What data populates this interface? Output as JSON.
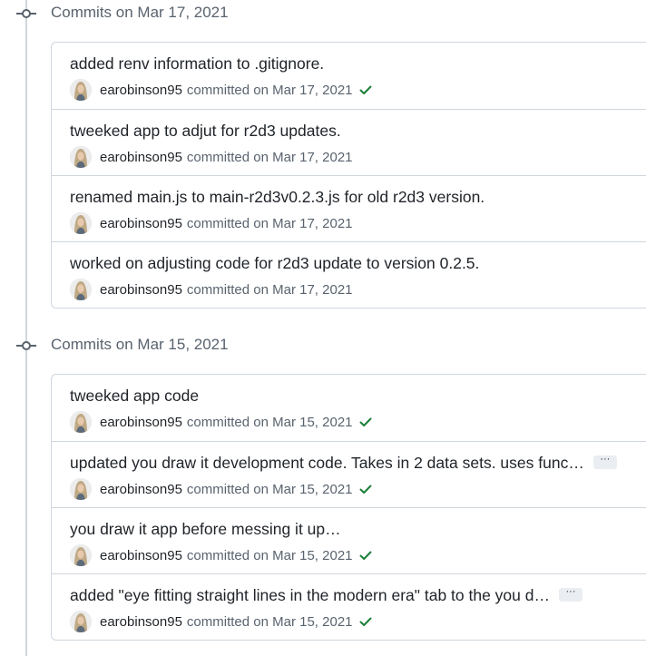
{
  "colors": {
    "line": "#d0d7de",
    "muted": "#59636e",
    "text": "#1f2328",
    "success": "#1a7f37"
  },
  "groups": [
    {
      "title": "Commits on Mar 17, 2021",
      "commits": [
        {
          "message": "added renv information to .gitignore.",
          "author": "earobinson95",
          "committed_text": "committed on Mar 17, 2021",
          "status": "success",
          "truncated": false
        },
        {
          "message": "tweeked app to adjut for r2d3 updates.",
          "author": "earobinson95",
          "committed_text": "committed on Mar 17, 2021",
          "status": "none",
          "truncated": false
        },
        {
          "message": "renamed main.js to main-r2d3v0.2.3.js for old r2d3 version.",
          "author": "earobinson95",
          "committed_text": "committed on Mar 17, 2021",
          "status": "none",
          "truncated": false
        },
        {
          "message": "worked on adjusting code for r2d3 update to version 0.2.5.",
          "author": "earobinson95",
          "committed_text": "committed on Mar 17, 2021",
          "status": "none",
          "truncated": false
        }
      ]
    },
    {
      "title": "Commits on Mar 15, 2021",
      "commits": [
        {
          "message": "tweeked app code",
          "author": "earobinson95",
          "committed_text": "committed on Mar 15, 2021",
          "status": "success",
          "truncated": false
        },
        {
          "message": "updated you draw it development code. Takes in 2 data sets. uses func…",
          "author": "earobinson95",
          "committed_text": "committed on Mar 15, 2021",
          "status": "success",
          "truncated": true
        },
        {
          "message": "you draw it app before messing it up…",
          "author": "earobinson95",
          "committed_text": "committed on Mar 15, 2021",
          "status": "success",
          "truncated": false
        },
        {
          "message": "added \"eye fitting straight lines in the modern era\" tab to the you d…",
          "author": "earobinson95",
          "committed_text": "committed on Mar 15, 2021",
          "status": "success",
          "truncated": true
        }
      ]
    }
  ],
  "icons": {
    "group": "git-commit-icon",
    "status": "check-icon",
    "expand": "ellipsis-icon",
    "ellipsis_glyph": "···"
  }
}
